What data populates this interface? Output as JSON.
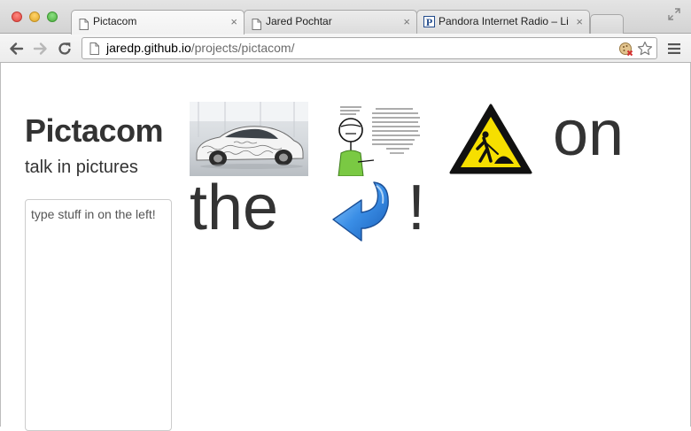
{
  "tabs": [
    {
      "title": "Pictacom",
      "active": true
    },
    {
      "title": "Jared Pochtar",
      "active": false
    },
    {
      "title": "Pandora Internet Radio – Li",
      "active": false
    }
  ],
  "address_bar": {
    "host": "jaredp.github.io",
    "path": "/projects/pictacom/"
  },
  "page": {
    "title": "Pictacom",
    "subtitle": "talk in pictures",
    "input_placeholder": "type stuff in on the left!",
    "output": {
      "images": [
        {
          "name": "camouflaged-sports-car-photo"
        },
        {
          "name": "stick-figure-comic-with-handwriting"
        },
        {
          "name": "construction-warning-sign-icon"
        },
        {
          "name": "blue-curved-left-arrow-icon"
        }
      ],
      "words": [
        "on",
        "the",
        "!"
      ]
    }
  },
  "colors": {
    "text": "#333333",
    "warning_yellow": "#f6df00",
    "arrow_blue": "#2f7fd8"
  }
}
